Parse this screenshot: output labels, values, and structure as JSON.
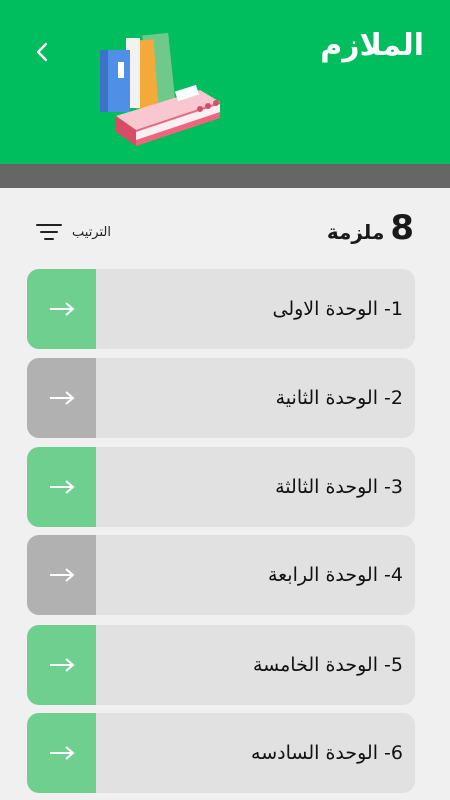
{
  "header": {
    "title": "الملازم",
    "back_icon": "chevron-left-icon",
    "background_color": "#00bd5e"
  },
  "summary": {
    "count": "8",
    "count_label": "ملزمة"
  },
  "sort": {
    "label": "الترتيب",
    "icon": "sort-lines-icon"
  },
  "units": [
    {
      "label": "1- الوحدة الاولى",
      "accent": "#6fcf8f"
    },
    {
      "label": "2-  الوحدة الثانية",
      "accent": "#b1b1b1"
    },
    {
      "label": "3- الوحدة الثالثة",
      "accent": "#6fcf8f"
    },
    {
      "label": "4- الوحدة الرابعة",
      "accent": "#b1b1b1"
    },
    {
      "label": "5- الوحدة الخامسة",
      "accent": "#6fcf8f"
    },
    {
      "label": "6- الوحدة السادسه",
      "accent": "#6fcf8f"
    }
  ]
}
